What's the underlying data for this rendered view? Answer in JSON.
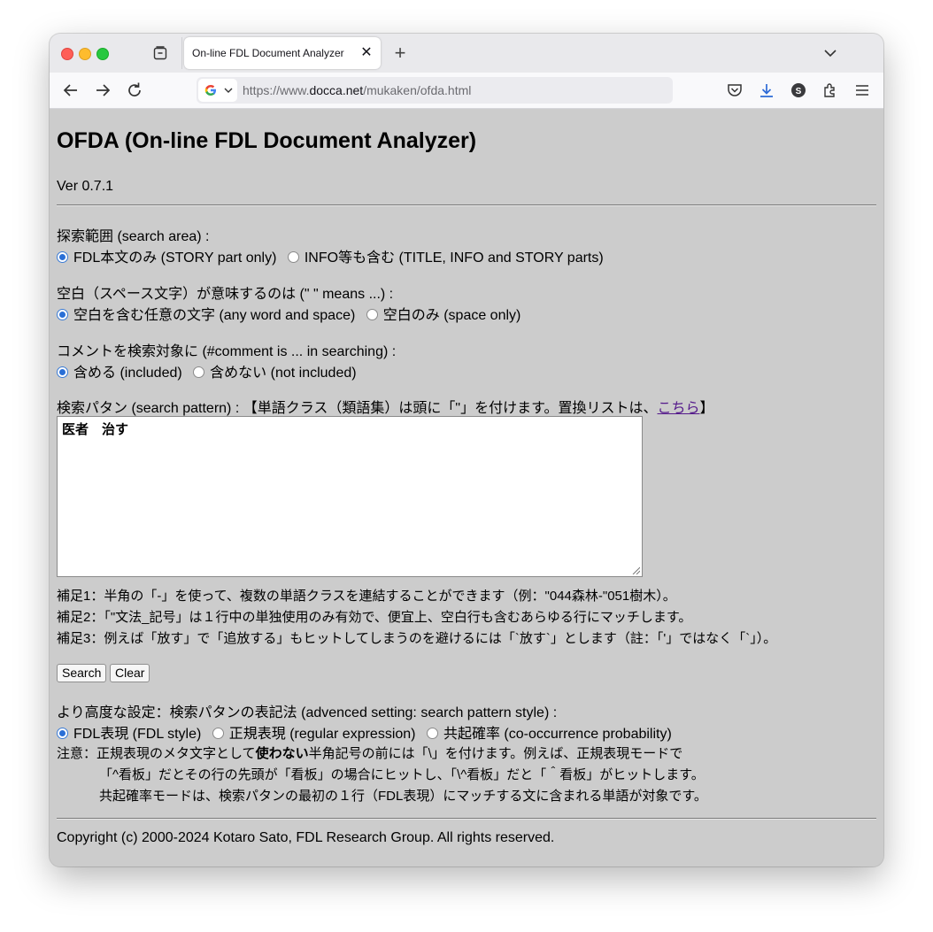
{
  "browser": {
    "tab_title": "On-line FDL Document Analyzer",
    "tab_close": "✕",
    "new_tab": "+",
    "url_prefix": "https://www.",
    "url_host": "docca.net",
    "url_path": "/mukaken/ofda.html",
    "icons": [
      "back-arrow-icon",
      "forward-arrow-icon",
      "reload-icon",
      "google-icon",
      "pocket-icon",
      "download-icon",
      "account-icon",
      "extensions-icon",
      "menu-icon",
      "tab-list-chevron-icon",
      "tab-overview-icon"
    ]
  },
  "page": {
    "title": "OFDA (On-line FDL Document Analyzer)",
    "version": "Ver 0.7.1",
    "search_area": {
      "label": "探索範囲 (search area) :",
      "options": [
        "FDL本文のみ (STORY part only)",
        "INFO等も含む (TITLE, INFO and STORY parts)"
      ],
      "selected": 0
    },
    "space_meaning": {
      "label": "空白（スペース文字）が意味するのは (\" \" means ...) :",
      "options": [
        "空白を含む任意の文字 (any word and space)",
        "空白のみ (space only)"
      ],
      "selected": 0
    },
    "comment": {
      "label": "コメントを検索対象に (#comment is ... in searching) :",
      "options": [
        "含める (included)",
        "含めない (not included)"
      ],
      "selected": 0
    },
    "pattern": {
      "label_before": "検索パタン (search pattern) : 【単語クラス（類語集）は頭に「\"」を付けます。置換リストは、",
      "link": "こちら",
      "label_after": "】",
      "value": "医者　治す"
    },
    "notes": [
      "補足1：半角の「-」を使って、複数の単語クラスを連結することができます（例：\"044森林-\"051樹木）。",
      "補足2：「\"文法_記号」は１行中の単独使用のみ有効で、便宜上、空白行も含むあらゆる行にマッチします。",
      "補足3：例えば「放す」で「追放する」もヒットしてしまうのを避けるには「`放す`」とします（註：「'」ではなく「`」）。"
    ],
    "buttons": {
      "search": "Search",
      "clear": "Clear"
    },
    "advanced": {
      "label": "より高度な設定：検索パタンの表記法 (advenced setting: search pattern style) :",
      "options": [
        "FDL表現 (FDL style)",
        "正規表現 (regular expression)",
        "共起確率 (co-occurrence probability)"
      ],
      "selected": 0
    },
    "caution": {
      "line1_a": "注意：正規表現のメタ文字として",
      "line1_bold": "使わない",
      "line1_b": "半角記号の前には「\\」を付けます。例えば、正規表現モードで",
      "line2": "「^看板」だとその行の先頭が「看板」の場合にヒットし、「\\^看板」だと「＾看板」がヒットします。",
      "line3": "共起確率モードは、検索パタンの最初の１行（FDL表現）にマッチする文に含まれる単語が対象です。"
    },
    "copyright": "Copyright (c) 2000-2024 Kotaro Sato, FDL Research Group. All rights reserved."
  }
}
